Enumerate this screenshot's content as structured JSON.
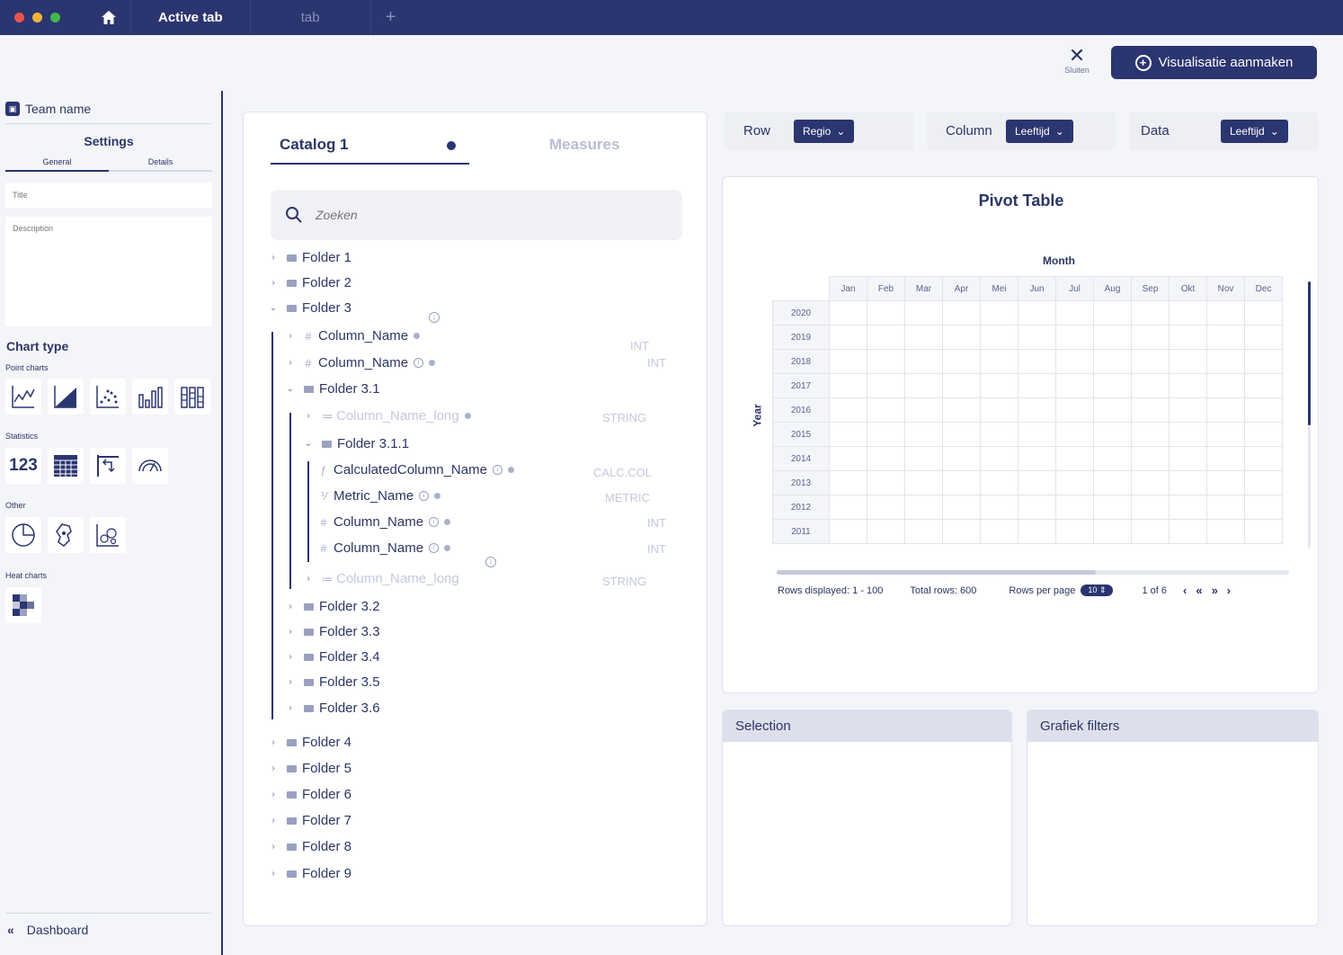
{
  "titlebar": {
    "tabs": [
      {
        "label": "Active tab"
      },
      {
        "label": "tab"
      }
    ],
    "new_tab": "+"
  },
  "actionbar": {
    "close_label": "Sluiten",
    "create_label": "Visualisatie aanmaken"
  },
  "sidebar": {
    "team_name": "Team name",
    "settings_title": "Settings",
    "subtabs": [
      "General",
      "Details"
    ],
    "title_placeholder": "Title",
    "description_placeholder": "Description",
    "chart_type_label": "Chart type",
    "groups": {
      "point": "Point charts",
      "statistics": "Statistics",
      "other": "Other",
      "heat": "Heat charts"
    },
    "point_icons": [
      "line-chart-icon",
      "area-chart-icon",
      "scatter-chart-icon",
      "bar-chart-icon",
      "stacked-bar-chart-icon"
    ],
    "statistics_icons": [
      "number-kpi-icon",
      "table-icon",
      "pivot-icon",
      "gauge-icon"
    ],
    "statistics_number_glyph": "123",
    "other_icons": [
      "pie-chart-icon",
      "map-icon",
      "bubble-chart-icon"
    ],
    "heat_icons": [
      "heatmap-icon"
    ],
    "dashboard_link": "Dashboard"
  },
  "catalog": {
    "tab_active": "Catalog 1",
    "tab_inactive": "Measures",
    "search_placeholder": "Zoeken",
    "tree": {
      "folder1": "Folder 1",
      "folder2": "Folder 2",
      "folder3": "Folder 3",
      "col1": "Column_Name",
      "col1_type": "INT",
      "col2": "Column_Name",
      "col2_type": "INT",
      "folder31": "Folder 3.1",
      "collong1": "Column_Name_long",
      "collong1_type": "STRING",
      "folder311": "Folder 3.1.1",
      "calc": "CalculatedColumn_Name",
      "calc_type": "CALC.COL",
      "metric": "Metric_Name",
      "metric_type": "METRIC",
      "col3": "Column_Name",
      "col3_type": "INT",
      "col4": "Column_Name",
      "col4_type": "INT",
      "collong2": "Column_Name_long",
      "collong2_type": "STRING",
      "folder32": "Folder 3.2",
      "folder33": "Folder 3.3",
      "folder34": "Folder 3.4",
      "folder35": "Folder 3.5",
      "folder36": "Folder 3.6",
      "folder4": "Folder 4",
      "folder5": "Folder 5",
      "folder6": "Folder 6",
      "folder7": "Folder 7",
      "folder8": "Folder 8",
      "folder9": "Folder 9"
    }
  },
  "selectors": {
    "row_label": "Row",
    "row_value": "Regio",
    "column_label": "Column",
    "column_value": "Leeftijd",
    "data_label": "Data",
    "data_value": "Leeftijd"
  },
  "pivot": {
    "title": "Pivot Table",
    "column_axis": "Month",
    "row_axis": "Year",
    "months": [
      "Jan",
      "Feb",
      "Mar",
      "Apr",
      "Mei",
      "Jun",
      "Jul",
      "Aug",
      "Sep",
      "Okt",
      "Nov",
      "Dec"
    ],
    "years": [
      "2020",
      "2019",
      "2018",
      "2017",
      "2016",
      "2015",
      "2014",
      "2013",
      "2012",
      "2011"
    ],
    "rows_displayed": "Rows displayed: 1 - 100",
    "total_rows": "Total rows: 600",
    "rows_per_page_label": "Rows per page",
    "rows_per_page_value": "10",
    "page_info": "1 of 6"
  },
  "panels": {
    "selection": "Selection",
    "filters": "Grafiek filters"
  },
  "colors": {
    "primary": "#2b3570",
    "panel_header": "#dde0ec",
    "background": "#f4f5f9"
  }
}
